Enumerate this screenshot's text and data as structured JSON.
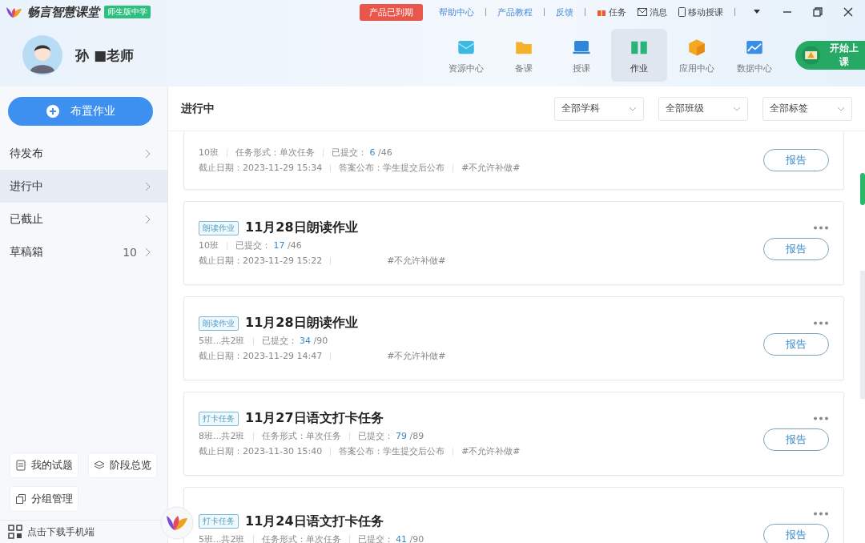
{
  "app": {
    "name": "畅言智慧课堂",
    "edition": "师生版中学",
    "notice": "产品已到期"
  },
  "top_links": [
    {
      "kind": "link",
      "label": "帮助中心"
    },
    {
      "kind": "link",
      "label": "产品教程"
    },
    {
      "kind": "link",
      "label": "反馈"
    },
    {
      "kind": "gift",
      "label": "任务"
    },
    {
      "kind": "mail",
      "label": "消息"
    },
    {
      "kind": "phone",
      "label": "移动授课"
    }
  ],
  "user": {
    "name": "孙 ■老师"
  },
  "nav": [
    {
      "kind": "resource",
      "label": "资源中心",
      "selected": false
    },
    {
      "kind": "folder",
      "label": "备课",
      "selected": false
    },
    {
      "kind": "screen",
      "label": "授课",
      "selected": false
    },
    {
      "kind": "book",
      "label": "作业",
      "selected": true
    },
    {
      "kind": "box",
      "label": "应用中心",
      "selected": false
    },
    {
      "kind": "chart",
      "label": "数据中心",
      "selected": false
    }
  ],
  "start_button": "开始上课",
  "sidebar": {
    "assign_button": "布置作业",
    "items": [
      {
        "label": "待发布",
        "selected": false
      },
      {
        "label": "进行中",
        "selected": true
      },
      {
        "label": "已截止",
        "selected": false
      },
      {
        "label": "草稿箱",
        "count": "10",
        "selected": false
      }
    ],
    "tools": [
      {
        "kind": "doc",
        "label": "我的试题"
      },
      {
        "kind": "layers",
        "label": "阶段总览"
      },
      {
        "kind": "copy",
        "label": "分组管理"
      }
    ],
    "download": "点击下载手机端"
  },
  "main": {
    "title": "进行中",
    "filters": [
      "全部学科",
      "全部班级",
      "全部标签"
    ],
    "cards": [
      {
        "classes": "10班",
        "form": "任务形式：单次任务",
        "submitted_label": "已提交：",
        "submitted": "6",
        "total": "/46",
        "deadline": "截止日期：2023-11-29 15:34",
        "answer": "答案公布：学生提交后公布",
        "rule": "#不允许补做#",
        "button": "报告",
        "more": false
      },
      {
        "tag": "朗读作业",
        "title": "11月28日朗读作业",
        "classes": "10班",
        "submitted_label": "已提交：",
        "submitted": "17",
        "total": "/46",
        "deadline": "截止日期：2023-11-29 15:22",
        "rule": "#不允许补做#",
        "button": "报告",
        "more": true
      },
      {
        "tag": "朗读作业",
        "title": "11月28日朗读作业",
        "classes": "5班...共2班",
        "submitted_label": "已提交：",
        "submitted": "34",
        "total": "/90",
        "deadline": "截止日期：2023-11-29 14:47",
        "rule": "#不允许补做#",
        "button": "报告",
        "more": true
      },
      {
        "tag": "打卡任务",
        "title": "11月27日语文打卡任务",
        "classes": "8班...共2班",
        "form": "任务形式：单次任务",
        "submitted_label": "已提交：",
        "submitted": "79",
        "total": "/89",
        "deadline": "截止日期：2023-11-30 15:40",
        "answer": "答案公布：学生提交后公布",
        "rule": "#不允许补做#",
        "button": "报告",
        "more": true
      },
      {
        "tag": "打卡任务",
        "title": "11月24日语文打卡任务",
        "classes": "5班...共2班",
        "form": "任务形式：单次任务",
        "submitted_label": "已提交：",
        "submitted": "41",
        "total": "/90",
        "button": "报告",
        "more": true
      }
    ]
  }
}
